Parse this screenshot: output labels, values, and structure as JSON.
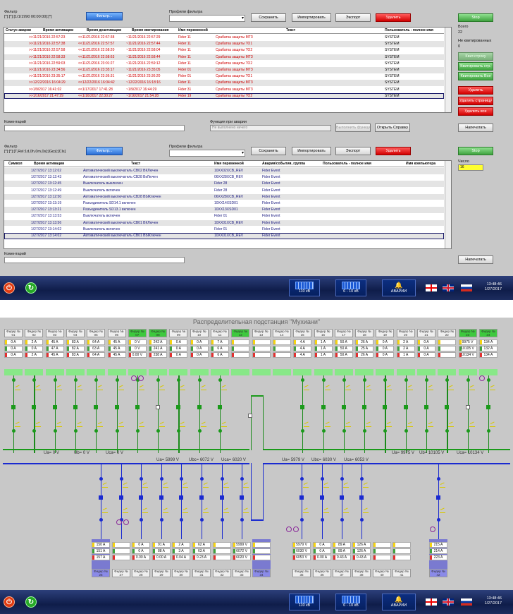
{
  "scr1": {
    "filter_label": "Фильтр",
    "filter_value": "[*]:[*]:[1/1/1990 00:00:00]:[*]",
    "filter_btn": "Фильтр...",
    "profiles_label": "Профили фильтра",
    "save": "Сохранить",
    "import": "Импортировать",
    "export": "Экспорт",
    "delete": "Удалить",
    "side": {
      "stop": "Stop",
      "total_label": "Всего",
      "total": "22",
      "noquit_label": "Не квитированных",
      "noquit": "0",
      "btn_quit": "Квит.строку",
      "btn_quit_page": "Квитировать стр.",
      "btn_quit_all": "Квитировать Все",
      "btn_del": "Удалить",
      "btn_del_page": "Удалить страницу",
      "btn_del_all": "Удалить все"
    },
    "cols": [
      "Статус аварии",
      "Время активации",
      "Время деактивации",
      "Время квитирования",
      "Имя переменной",
      "Текст",
      "Пользователь - полное имя"
    ],
    "rows": [
      [
        ">>11/21/2016 22:57:23",
        "<<11/21/2016 22:57:38",
        "~11/21/2016 22:57:29",
        "Fider 11",
        "Срабатка защиты МТЗ",
        "SYSTEM"
      ],
      [
        ">>11/21/2016 22:57:38",
        "<<11/21/2016 22:57:57",
        "~11/21/2016 22:57:44",
        "Fider 11",
        "Срабатка защиты ТО1",
        "SYSTEM"
      ],
      [
        ">>11/21/2016 22:57:58",
        "<<11/21/2016 22:58:20",
        "~11/21/2016 22:58:04",
        "Fider 11",
        "Срабатка защиты ТО2",
        "SYSTEM"
      ],
      [
        ">>11/21/2016 22:58:33",
        "<<11/21/2016 22:58:63",
        "~11/21/2016 22:58:44",
        "Fider 11",
        "Срабатка защиты МТЗ",
        "SYSTEM"
      ],
      [
        ">>11/21/2016 22:59:03",
        "<<11/21/2016 23:01:27",
        "~11/21/2016 22:59:12",
        "Fider 11",
        "Срабатка защиты ТО2",
        "SYSTEM"
      ],
      [
        ">>11/21/2016 23:34:56",
        "<<11/21/2016 23:35:17",
        "~11/21/2016 23:35:05",
        "Fider 01",
        "Срабатка защиты МТЗ",
        "SYSTEM"
      ],
      [
        ">>11/21/2016 23:35:17",
        "<<11/21/2016 23:36:31",
        "~11/21/2016 23:36:20",
        "Fider 01",
        "Срабатка защиты ТО1",
        "SYSTEM"
      ],
      [
        ">>12/22/2016 16:04:29",
        "<<12/22/2016 16:04:42",
        "~12/22/2016 16:18:16",
        "Fider 11",
        "Срабатка защиты МТЗ",
        "SYSTEM"
      ],
      [
        ">>1/9/2017 16:41:02",
        "<<1/17/2017 17:41:28",
        "~1/9/2017 16:44:29",
        "Fider 31",
        "Срабатка защиты МТЗ",
        "SYSTEM"
      ],
      [
        ">>1/16/2017 21:47:29",
        "<<1/16/2017 22:30:27",
        "~1/16/2017 21:54:28",
        "Fider 19",
        "Срабатка защиты ТО2",
        "SYSTEM"
      ]
    ],
    "comment_label": "Коментарий",
    "func_label": "Функция при аварии",
    "func_value": "Не выполнено ничего",
    "func_btn": "Выполнить функцию",
    "help_btn": "Открыть Справку",
    "print_btn": "Напечатать",
    "filter2_value": "[*]:[*]:[T,Rel:1d,0h,0m,0s]:[Grp]:[Cls]",
    "number_label": "Число",
    "number_value": "16",
    "cols2": [
      "Символ",
      "Время активации",
      "Текст",
      "Имя переменной",
      "Авария/события, группа",
      "Пользователь - полное имя",
      "Имя компьютера"
    ],
    "rows2": [
      [
        "1/27/2017 13:12:02",
        "Автоматический выключатель CB02 ВКЛючен",
        "10ХХ02XCB_REV",
        "Fider Event"
      ],
      [
        "1/27/2017 13:12:43",
        "Автоматический выключатель CB28 ВкЛючен",
        "06ХХ28XCB_REV",
        "Fider Event"
      ],
      [
        "1/27/2017 13:12:45",
        "Выключатель выключен",
        "Fider 28",
        "Fider Event"
      ],
      [
        "1/27/2017 13:12:49",
        "Выключатель включен",
        "Fider 28",
        "Fider Event"
      ],
      [
        "1/27/2017 13:12:50",
        "Автоматический выключатель CB28 ВЫКлючен",
        "06ХХ28XCB_REV",
        "Fider Event"
      ],
      [
        "1/27/2017 13:13:19",
        "Разъединитель SD14.1 включен",
        "10ХХ14XSD01",
        "Fider Event"
      ],
      [
        "1/27/2017 13:13:21",
        "Разъединитель SD13.1 включен",
        "10ХХ13XSD01",
        "Fider Event"
      ],
      [
        "1/27/2017 13:13:53",
        "Выключатель включен",
        "Fider 01",
        "Fider Event"
      ],
      [
        "1/27/2017 13:13:56",
        "Автоматический выключатель CB01 ВКЛючен",
        "10ХХ01XCB_REV",
        "Fider Event"
      ],
      [
        "1/27/2017 13:14:02",
        "Выключатель включен",
        "Fider 01",
        "Fider Event"
      ],
      [
        "1/27/2017 13:14:02",
        "Автоматический выключатель CB01 ВЫКлючен",
        "10ХХ01XCB_REV",
        "Fider Event"
      ]
    ]
  },
  "taskbar": {
    "sw1": "110 кВ",
    "sw2": "6 - 10 кВ",
    "alarm": "АВАРИИ",
    "time": "13:48:46",
    "date": "1/27/2017"
  },
  "scr2": {
    "title": "Распределительная подстанция \"Мухиани\"",
    "top_feeders": [
      {
        "h": "Фидер № 01",
        "v": [
          "0 A",
          "0 A",
          "0 A"
        ]
      },
      {
        "h": "Фидер № 02",
        "v": [
          "2 A",
          "0 A",
          "2 A"
        ]
      },
      {
        "h": "Фидер № 03",
        "v": [
          "45 A",
          "47 A",
          "45 A"
        ]
      },
      {
        "h": "Фидер № 04",
        "v": [
          "83 A",
          "82 A",
          "83 A"
        ]
      },
      {
        "h": "Фидер № 05",
        "v": [
          "64 A",
          "63 A",
          "64 A"
        ]
      },
      {
        "h": "Фидер № 06",
        "v": [
          "45 A",
          "45 A",
          "45 A"
        ]
      },
      {
        "h": "Фидер № 07",
        "v": [
          "0 V",
          "0 V",
          "0.00 V"
        ],
        "g": true
      },
      {
        "h": "Фидер № 08",
        "v": [
          "242 A",
          "241 A",
          "238 A"
        ],
        "g": true
      },
      {
        "h": "Фидер № 09",
        "v": [
          "0 A",
          "0 A",
          "0 A"
        ]
      },
      {
        "h": "Фидер № 10",
        "v": [
          "0 A",
          "0 A",
          "0 A"
        ]
      },
      {
        "h": "Фидер № 11",
        "v": [
          "7 A",
          "6 A",
          "6 A"
        ]
      },
      {
        "h": "Фидер № 12",
        "v": [
          "",
          "",
          ""
        ],
        "g": true
      },
      {
        "h": "Фидер № 13",
        "v": [
          "",
          "",
          ""
        ]
      },
      {
        "h": "Фидер № 14",
        "v": [
          "",
          "",
          ""
        ]
      },
      {
        "h": "Фидер № 15",
        "v": [
          "4 A",
          "4 A",
          "4 A"
        ]
      },
      {
        "h": "Фидер № 16",
        "v": [
          "1 A",
          "1 A",
          "1 A"
        ]
      },
      {
        "h": "Фидер № 17",
        "v": [
          "50 A",
          "50 A",
          "50 A"
        ]
      },
      {
        "h": "Фидер № 18",
        "v": [
          "26 A",
          "25 A",
          "26 A"
        ]
      },
      {
        "h": "Фидер № 19",
        "v": [
          "0 A",
          "0 A",
          "0 A"
        ]
      },
      {
        "h": "Фидер № 20",
        "v": [
          "2 A",
          "2 A",
          "1 A"
        ]
      },
      {
        "h": "Фидер № 21",
        "v": [
          "0 A",
          "0 A",
          "0 A"
        ]
      },
      {
        "h": "Фидер № 22",
        "v": [
          "",
          "",
          ""
        ]
      },
      {
        "h": "Фидер № 23",
        "v": [
          "9975 V",
          "10105 V",
          "10134 V"
        ],
        "g": true
      },
      {
        "h": "Фидер № 24",
        "v": [
          "134 A",
          "132 A",
          "134 A"
        ],
        "g": true
      }
    ],
    "bus_left": {
      "ua": "Ua= 0 V",
      "ub": "Ub= 0 V",
      "uc": "Uca= 0 V"
    },
    "bus_right": {
      "ua": "Ua= 9975 V",
      "ub": "Ub= 10105 V",
      "uc": "Uca= 10134 V"
    },
    "bus_low_left": {
      "ua": "Ua= 5999 V",
      "ub": "Ubc= 6072 V",
      "uc": "Uca= 6020 V"
    },
    "bus_low_right": {
      "ua": "Ua= 5979 V",
      "ub": "Ubc= 6030 V",
      "uc": "Uca= 6053 V"
    },
    "bottom_feeders": [
      {
        "h": "Фидер № 25",
        "v": [
          "150 A",
          "151 A",
          "157 A"
        ],
        "c": "b"
      },
      {
        "h": "Фидер № 27",
        "v": [
          "",
          "",
          ""
        ]
      },
      {
        "h": "Фидер № 28",
        "v": [
          "0 A",
          "0 A",
          "0.00 A"
        ]
      },
      {
        "h": "Фидер № 29",
        "v": [
          "91 A",
          "88 A",
          "0.00 A"
        ]
      },
      {
        "h": "Фидер № 30",
        "v": [
          "2 A",
          "3 A",
          "0.04 A"
        ]
      },
      {
        "h": "Фидер № 31",
        "v": [
          "62 A",
          "63 A",
          "0.23 A"
        ]
      },
      {
        "h": "Фидер № 32",
        "v": [
          "",
          "",
          ""
        ]
      },
      {
        "h": "Фидер № 33",
        "v": [
          "5999 V",
          "6072 V",
          "6020 V"
        ]
      },
      {
        "h": "Фидер № 34",
        "v": [
          "",
          "",
          ""
        ],
        "c": "b"
      },
      {
        "h": "Фидер № 35",
        "v": [
          "5979 V",
          "6030 V",
          "6053 V"
        ]
      },
      {
        "h": "Фидер № 36",
        "v": [
          "0 A",
          "0 A",
          "0.00 A"
        ]
      },
      {
        "h": "Фидер № 37",
        "v": [
          "89 A",
          "89 A",
          "0.43 A"
        ]
      },
      {
        "h": "Фидер № 38",
        "v": [
          "126 A",
          "126 A",
          "0.43 A"
        ]
      },
      {
        "h": "Фидер № 40",
        "v": [
          "",
          "",
          ""
        ]
      },
      {
        "h": "Фидер № 41",
        "v": [
          "",
          "",
          ""
        ]
      },
      {
        "h": "Фидер № 42",
        "v": [
          "215 A",
          "214 A",
          "223 A"
        ],
        "c": "b"
      }
    ]
  },
  "colors": {
    "accent": "#2c6fd6",
    "alarm": "#d00000",
    "ok": "#3fa23f",
    "bus_green": "#1a9a1a",
    "bus_blue": "#1a2ad0"
  }
}
